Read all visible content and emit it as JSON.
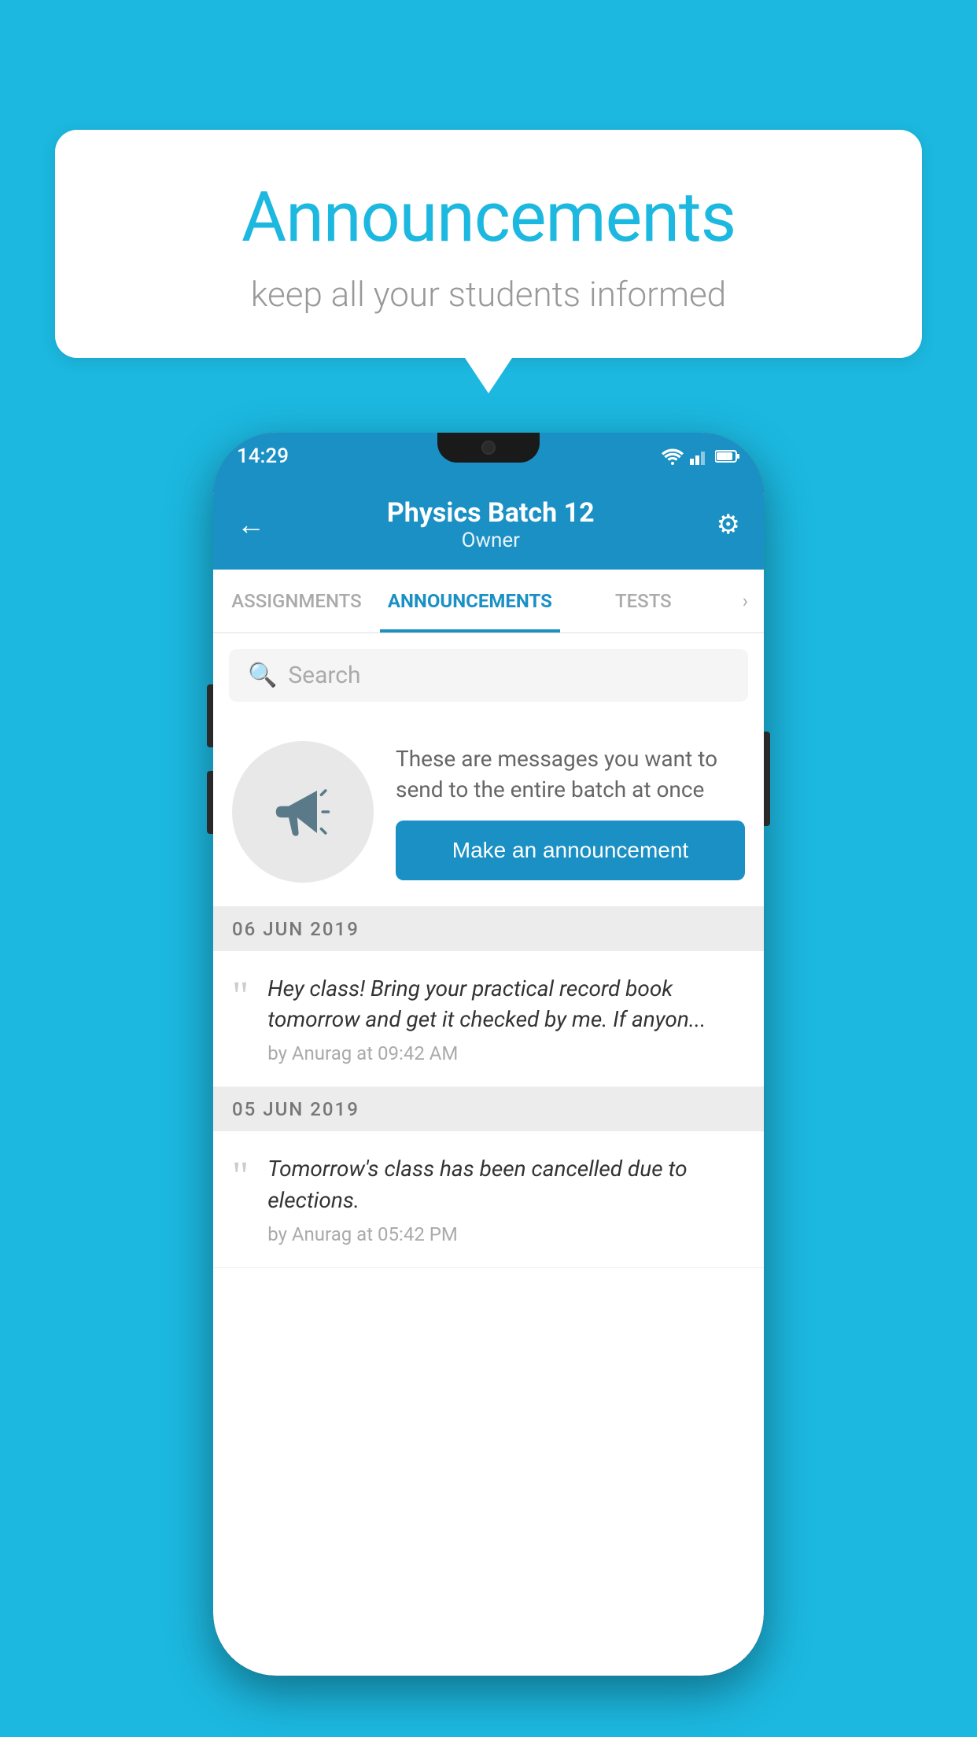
{
  "background_color": "#1cb8e0",
  "speech_bubble": {
    "title": "Announcements",
    "subtitle": "keep all your students informed"
  },
  "phone": {
    "status_bar": {
      "time": "14:29"
    },
    "header": {
      "title": "Physics Batch 12",
      "subtitle": "Owner",
      "back_label": "←",
      "gear_label": "⚙"
    },
    "tabs": [
      {
        "label": "ASSIGNMENTS",
        "active": false
      },
      {
        "label": "ANNOUNCEMENTS",
        "active": true
      },
      {
        "label": "TESTS",
        "active": false
      }
    ],
    "search": {
      "placeholder": "Search"
    },
    "cta": {
      "description": "These are messages you want to send to the entire batch at once",
      "button_label": "Make an announcement"
    },
    "announcements": [
      {
        "date": "06  JUN  2019",
        "text": "Hey class! Bring your practical record book tomorrow and get it checked by me. If anyon...",
        "meta": "by Anurag at 09:42 AM"
      },
      {
        "date": "05  JUN  2019",
        "text": "Tomorrow's class has been cancelled due to elections.",
        "meta": "by Anurag at 05:42 PM"
      }
    ]
  }
}
